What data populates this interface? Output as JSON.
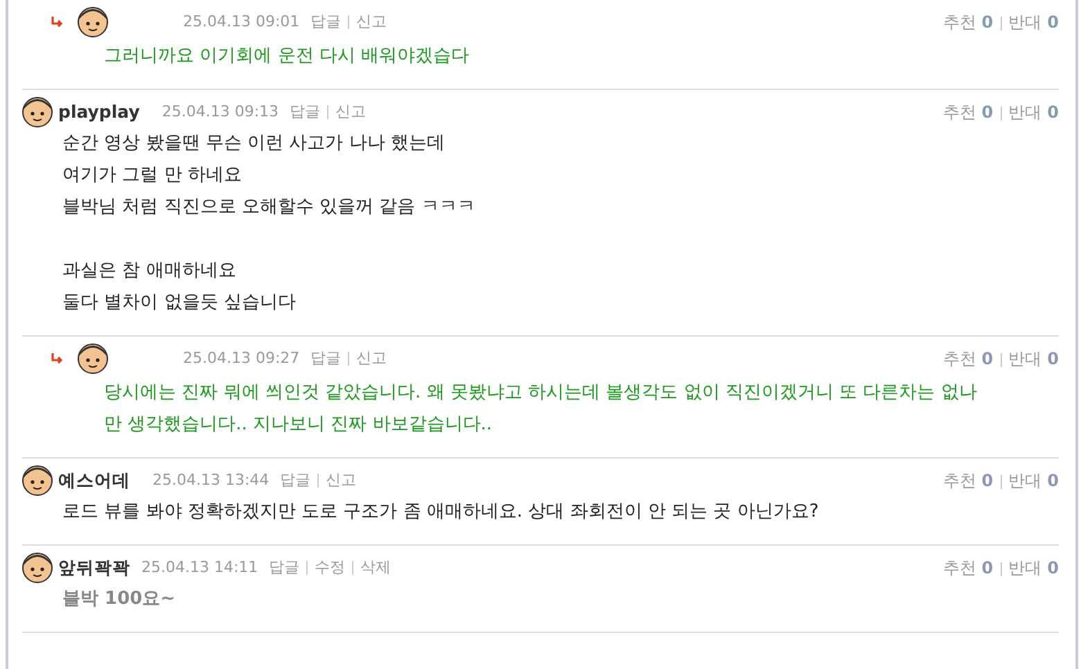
{
  "comments": [
    {
      "kind": "reply",
      "date": "25.04.13 09:01",
      "actions": [
        "답글",
        "신고"
      ],
      "paragraphs": [
        [
          "그러니까요 이기회에 운전 다시 배워야겠습다"
        ]
      ],
      "votes": {
        "up_label": "추천",
        "up": "0",
        "down_label": "반대",
        "down": "0"
      }
    },
    {
      "kind": "comment",
      "author": "playplay",
      "date": "25.04.13 09:13",
      "actions": [
        "답글",
        "신고"
      ],
      "paragraphs": [
        [
          "순간 영상 봤을땐 무슨 이런 사고가 나나 했는데",
          "여기가 그럴 만 하네요",
          "블박님 처럼 직진으로 오해할수 있을꺼 같음 ㅋㅋㅋ"
        ],
        [
          "과실은 참 애매하네요",
          "둘다 별차이 없을듯 싶습니다"
        ]
      ],
      "votes": {
        "up_label": "추천",
        "up": "0",
        "down_label": "반대",
        "down": "0"
      }
    },
    {
      "kind": "reply",
      "date": "25.04.13 09:27",
      "actions": [
        "답글",
        "신고"
      ],
      "paragraphs": [
        [
          "당시에는 진짜 뭐에 씌인것 같았습니다. 왜 못봤냐고 하시는데 볼생각도 없이 직진이겠거니 또 다른차는 없나",
          "만 생각했습니다.. 지나보니 진짜 바보같습니다.."
        ]
      ],
      "votes": {
        "up_label": "추천",
        "up": "0",
        "down_label": "반대",
        "down": "0"
      }
    },
    {
      "kind": "comment",
      "author": "예스어데",
      "date": "25.04.13 13:44",
      "actions": [
        "답글",
        "신고"
      ],
      "paragraphs": [
        [
          "로드 뷰를 봐야 정확하겠지만 도로 구조가 좀 애매하네요. 상대 좌회전이 안 되는 곳 아닌가요?"
        ]
      ],
      "votes": {
        "up_label": "추천",
        "up": "0",
        "down_label": "반대",
        "down": "0"
      }
    },
    {
      "kind": "own",
      "author": "앞뒤꽉꽉",
      "date": "25.04.13 14:11",
      "actions": [
        "답글",
        "수정",
        "삭제"
      ],
      "paragraphs": [
        [
          "블박 100요~"
        ]
      ],
      "votes": {
        "up_label": "추천",
        "up": "0",
        "down_label": "반대",
        "down": "0"
      }
    }
  ]
}
